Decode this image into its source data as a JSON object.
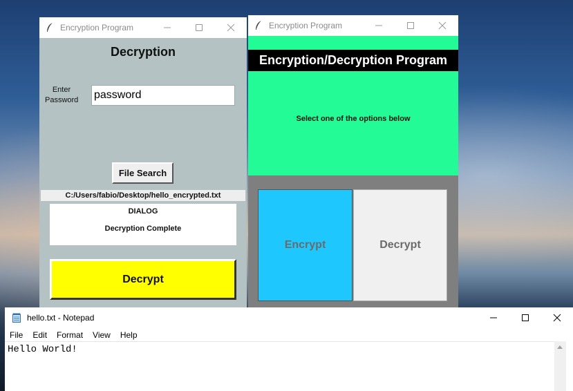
{
  "decryption_window": {
    "title": "Encryption Program",
    "heading": "Decryption",
    "password_label": "Enter\nPassword",
    "password_value": "password",
    "file_search_label": "File Search",
    "file_path": "C:/Users/fabio/Desktop/hello_encrypted.txt",
    "dialog_title": "DIALOG",
    "dialog_message": "Decryption Complete",
    "decrypt_button": "Decrypt"
  },
  "main_window": {
    "title": "Encryption Program",
    "banner": "Encryption/Decryption Program",
    "instruction": "Select one of the options below",
    "encrypt_button": "Encrypt",
    "decrypt_button": "Decrypt"
  },
  "notepad": {
    "title": "hello.txt - Notepad",
    "menu": [
      "File",
      "Edit",
      "Format",
      "View",
      "Help"
    ],
    "content": "Hello World!"
  },
  "colors": {
    "decryption_bg": "#b5c2c4",
    "green_panel": "#22fb96",
    "encrypt_button": "#1fc7ff",
    "decrypt_big_button": "#ffff00"
  }
}
